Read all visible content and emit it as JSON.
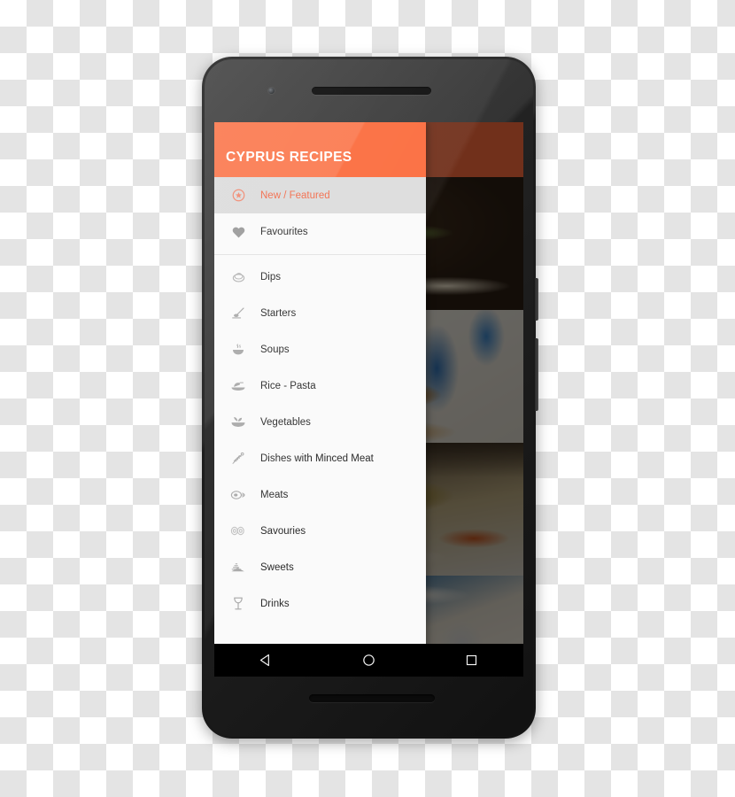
{
  "app": {
    "drawer_title": "CYPRUS RECIPES",
    "accent_color": "#FB6B3C",
    "selected_text_color": "#F26B4A",
    "selected_row_color": "#DCDCDC"
  },
  "drawer": {
    "groups": [
      {
        "items": [
          {
            "label": "New / Featured",
            "icon": "star-circle-icon",
            "selected": true
          },
          {
            "label": "Favourites",
            "icon": "heart-icon",
            "selected": false
          }
        ]
      },
      {
        "items": [
          {
            "label": "Dips",
            "icon": "dip-bowl-icon",
            "selected": false
          },
          {
            "label": "Starters",
            "icon": "starters-spoon-icon",
            "selected": false
          },
          {
            "label": "Soups",
            "icon": "soup-bowl-icon",
            "selected": false
          },
          {
            "label": "Rice - Pasta",
            "icon": "rice-plate-icon",
            "selected": false
          },
          {
            "label": "Vegetables",
            "icon": "vegetables-bowl-icon",
            "selected": false
          },
          {
            "label": "Dishes with Minced Meat",
            "icon": "minced-meat-icon",
            "selected": false
          },
          {
            "label": "Meats",
            "icon": "meat-leg-icon",
            "selected": false
          },
          {
            "label": "Savouries",
            "icon": "savouries-icon",
            "selected": false
          },
          {
            "label": "Sweets",
            "icon": "cake-slice-icon",
            "selected": false
          },
          {
            "label": "Drinks",
            "icon": "wine-glass-icon",
            "selected": false
          }
        ]
      }
    ]
  },
  "background_content": {
    "photos": [
      {
        "name": "grilled-fish-photo"
      },
      {
        "name": "fried-croquettes-photo"
      },
      {
        "name": "baked-rice-pie-photo"
      },
      {
        "name": "meat-plate-photo"
      }
    ]
  },
  "system_nav": {
    "back_label": "Back",
    "home_label": "Home",
    "recents_label": "Recent apps"
  }
}
